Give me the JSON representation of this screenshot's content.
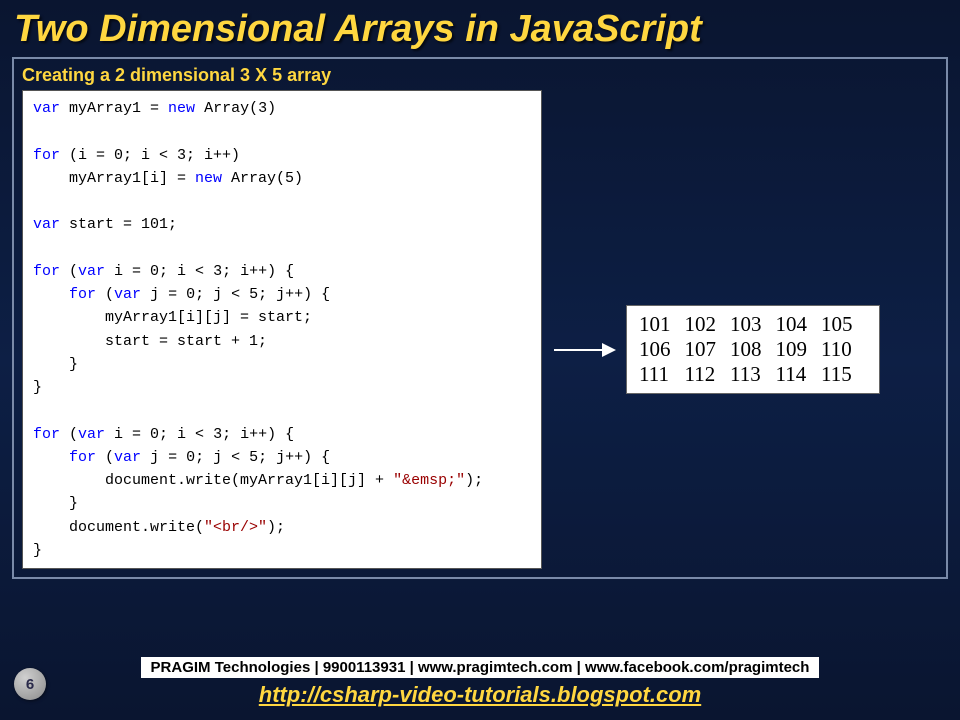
{
  "title": "Two Dimensional Arrays in JavaScript",
  "caption": "Creating a 2 dimensional 3 X 5 array",
  "code": [
    [
      {
        "t": "var",
        "c": "kw"
      },
      {
        "t": " myArray1 = ",
        "c": "tx"
      },
      {
        "t": "new",
        "c": "kw"
      },
      {
        "t": " Array(3)",
        "c": "tx"
      }
    ],
    [
      {
        "t": "",
        "c": "tx"
      }
    ],
    [
      {
        "t": "for",
        "c": "kw"
      },
      {
        "t": " (i = 0; i < 3; i++)",
        "c": "tx"
      }
    ],
    [
      {
        "t": "    myArray1[i] = ",
        "c": "tx"
      },
      {
        "t": "new",
        "c": "kw"
      },
      {
        "t": " Array(5)",
        "c": "tx"
      }
    ],
    [
      {
        "t": "",
        "c": "tx"
      }
    ],
    [
      {
        "t": "var",
        "c": "kw"
      },
      {
        "t": " start = 101;",
        "c": "tx"
      }
    ],
    [
      {
        "t": "",
        "c": "tx"
      }
    ],
    [
      {
        "t": "for",
        "c": "kw"
      },
      {
        "t": " (",
        "c": "tx"
      },
      {
        "t": "var",
        "c": "kw"
      },
      {
        "t": " i = 0; i < 3; i++) {",
        "c": "tx"
      }
    ],
    [
      {
        "t": "    ",
        "c": "tx"
      },
      {
        "t": "for",
        "c": "kw"
      },
      {
        "t": " (",
        "c": "tx"
      },
      {
        "t": "var",
        "c": "kw"
      },
      {
        "t": " j = 0; j < 5; j++) {",
        "c": "tx"
      }
    ],
    [
      {
        "t": "        myArray1[i][j] = start;",
        "c": "tx"
      }
    ],
    [
      {
        "t": "        start = start + 1;",
        "c": "tx"
      }
    ],
    [
      {
        "t": "    }",
        "c": "tx"
      }
    ],
    [
      {
        "t": "}",
        "c": "tx"
      }
    ],
    [
      {
        "t": "",
        "c": "tx"
      }
    ],
    [
      {
        "t": "for",
        "c": "kw"
      },
      {
        "t": " (",
        "c": "tx"
      },
      {
        "t": "var",
        "c": "kw"
      },
      {
        "t": " i = 0; i < 3; i++) {",
        "c": "tx"
      }
    ],
    [
      {
        "t": "    ",
        "c": "tx"
      },
      {
        "t": "for",
        "c": "kw"
      },
      {
        "t": " (",
        "c": "tx"
      },
      {
        "t": "var",
        "c": "kw"
      },
      {
        "t": " j = 0; j < 5; j++) {",
        "c": "tx"
      }
    ],
    [
      {
        "t": "        document.write(myArray1[i][j] + ",
        "c": "tx"
      },
      {
        "t": "\"&emsp;\"",
        "c": "br"
      },
      {
        "t": ");",
        "c": "tx"
      }
    ],
    [
      {
        "t": "    }",
        "c": "tx"
      }
    ],
    [
      {
        "t": "    document.write(",
        "c": "tx"
      },
      {
        "t": "\"<br/>\"",
        "c": "br"
      },
      {
        "t": ");",
        "c": "tx"
      }
    ],
    [
      {
        "t": "}",
        "c": "tx"
      }
    ]
  ],
  "output": [
    [
      "101",
      "102",
      "103",
      "104",
      "105"
    ],
    [
      "106",
      "107",
      "108",
      "109",
      "110"
    ],
    [
      "111",
      "112",
      "113",
      "114",
      "115"
    ]
  ],
  "footer_bar": "PRAGIM Technologies | 9900113931 | www.pragimtech.com | www.facebook.com/pragimtech",
  "footer_link": "http://csharp-video-tutorials.blogspot.com",
  "page_num": "6"
}
